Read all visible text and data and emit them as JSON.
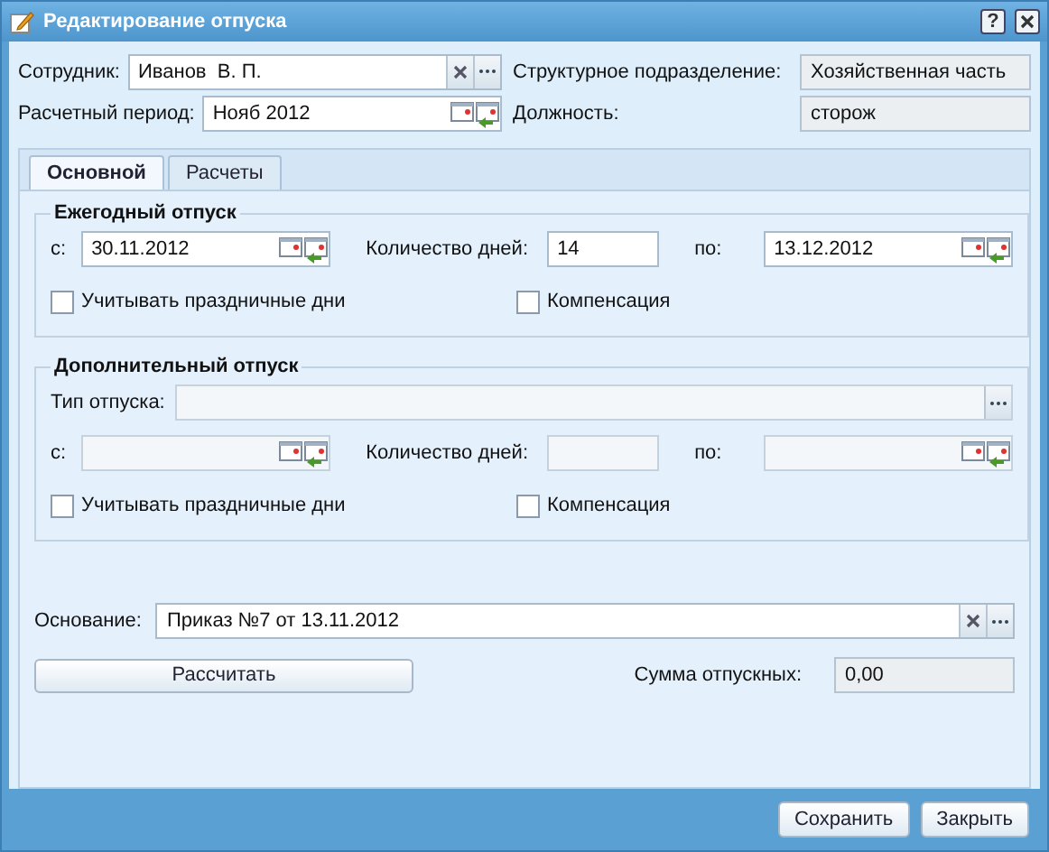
{
  "window": {
    "title": "Редактирование отпуска",
    "help_glyph": "?"
  },
  "header_fields": [
    {
      "label": "Сотрудник:",
      "value": "Иванов  В. П.",
      "kind": "lookup"
    },
    {
      "label": "Структурное подразделение:",
      "value": "Хозяйственная часть",
      "kind": "readonly"
    },
    {
      "label": "Расчетный период:",
      "value": "Нояб 2012",
      "kind": "date"
    },
    {
      "label": "Должность:",
      "value": "сторож",
      "kind": "readonly"
    }
  ],
  "tabs": [
    {
      "label": "Основной",
      "selected": true
    },
    {
      "label": "Расчеты",
      "selected": false
    }
  ],
  "sections": [
    {
      "title": "Ежегодный отпуск",
      "disabled": false,
      "from": {
        "label": "с:",
        "value": "30.11.2012"
      },
      "days": {
        "label": "Количество дней:",
        "value": "14"
      },
      "to": {
        "label": "по:",
        "value": "13.12.2012"
      },
      "checkboxes": [
        {
          "label": "Учитывать праздничные дни",
          "checked": false
        },
        {
          "label": "Компенсация",
          "checked": false
        }
      ]
    },
    {
      "title": "Дополнительный отпуск",
      "disabled": true,
      "type_field": {
        "label": "Тип отпуска:"
      },
      "from": {
        "label": "с:"
      },
      "days": {
        "label": "Количество дней:"
      },
      "to": {
        "label": "по:"
      },
      "checkboxes": [
        {
          "label": "Учитывать праздничные дни",
          "checked": false
        },
        {
          "label": "Компенсация",
          "checked": false
        }
      ]
    }
  ],
  "basis": {
    "label": "Основание:",
    "value": "Приказ №7 от 13.11.2012"
  },
  "calc_button": "Рассчитать",
  "total": {
    "label": "Сумма отпускных:",
    "value": "0,00"
  },
  "buttons": [
    "Сохранить",
    "Закрыть"
  ]
}
